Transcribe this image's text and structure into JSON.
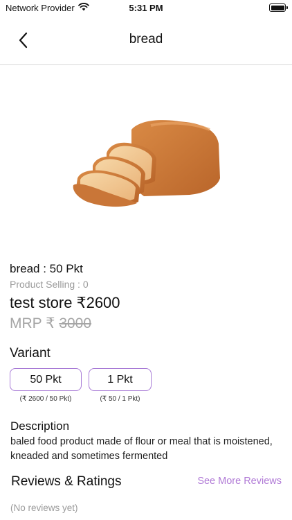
{
  "status_bar": {
    "carrier": "Network Provider",
    "time": "5:31 PM",
    "wifi_icon": "wifi-icon",
    "battery_icon": "battery-icon"
  },
  "nav": {
    "back_icon": "chevron-left-icon",
    "title": "bread"
  },
  "product": {
    "image_name": "bread-loaf-image",
    "name_line": "bread : 50 Pkt",
    "selling_line": "Product Selling : 0",
    "store_price_line": "test store ₹2600",
    "mrp_prefix": "MRP ₹ ",
    "mrp_value": "3000"
  },
  "variant": {
    "heading": "Variant",
    "options": [
      {
        "label": "50 Pkt",
        "sub": "(₹ 2600 / 50 Pkt)"
      },
      {
        "label": "1 Pkt",
        "sub": "(₹ 50 / 1 Pkt)"
      }
    ],
    "accent_color": "#a77ad6"
  },
  "description": {
    "heading": "Description",
    "text": "baled food product made of flour or meal that is moistened, kneaded and sometimes fermented"
  },
  "reviews": {
    "heading": "Reviews & Ratings",
    "see_more": "See More Reviews",
    "empty": "(No reviews yet)",
    "link_color": "#b07ad6"
  }
}
